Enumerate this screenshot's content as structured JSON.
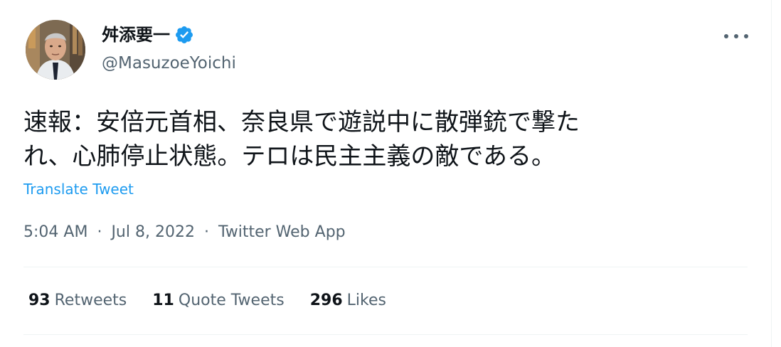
{
  "author": {
    "display_name": "舛添要一",
    "handle": "@MasuzoeYoichi",
    "verified": true
  },
  "tweet": {
    "text_line1": "速報：安倍元首相、奈良県で遊説中に散弾銃で撃た",
    "text_line2": "れ、心肺停止状態。テロは民主主義の敵である。",
    "translate_label": "Translate Tweet"
  },
  "meta": {
    "time": "5:04 AM",
    "separator": "·",
    "date": "Jul 8, 2022",
    "source": "Twitter Web App"
  },
  "stats": {
    "retweets_count": "93",
    "retweets_label": "Retweets",
    "quotes_count": "11",
    "quotes_label": "Quote Tweets",
    "likes_count": "296",
    "likes_label": "Likes"
  },
  "colors": {
    "accent": "#1d9bf0",
    "secondary_text": "#536471",
    "primary_text": "#0f1419",
    "divider": "#eff3f4"
  },
  "icons": {
    "verified": "verified-badge-icon",
    "more": "more-options-icon"
  }
}
